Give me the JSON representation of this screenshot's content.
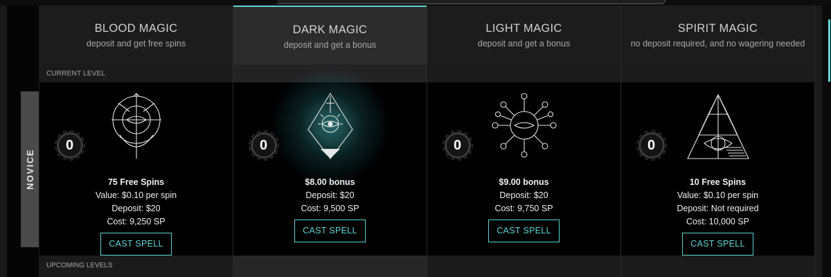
{
  "level": {
    "name": "NOVICE"
  },
  "labels": {
    "current_level": "CURRENT LEVEL",
    "upcoming_levels": "UPCOMING LEVELS"
  },
  "accent": "#5ed6d6",
  "columns": [
    {
      "title": "BLOOD MAGIC",
      "subtitle": "deposit and get free spins",
      "badge": "0",
      "icon": "blood-magic-sigil-icon",
      "offer": [
        "75 Free Spins",
        "Value: $0.10 per spin",
        "Deposit: $20",
        "Cost: 9,250 SP"
      ],
      "button": "CAST SPELL",
      "active": false
    },
    {
      "title": "DARK MAGIC",
      "subtitle": "deposit and get a bonus",
      "badge": "0",
      "icon": "dark-magic-sigil-icon",
      "offer": [
        "$8.00 bonus",
        "Deposit: $20",
        "Cost: 9,500 SP"
      ],
      "button": "CAST SPELL",
      "active": true
    },
    {
      "title": "LIGHT MAGIC",
      "subtitle": "deposit and get a bonus",
      "badge": "0",
      "icon": "light-magic-sigil-icon",
      "offer": [
        "$9.00 bonus",
        "Deposit: $20",
        "Cost: 9,750 SP"
      ],
      "button": "CAST SPELL",
      "active": false
    },
    {
      "title": "SPIRIT MAGIC",
      "subtitle": "no deposit required, and no wagering needed",
      "badge": "0",
      "icon": "spirit-magic-sigil-icon",
      "offer": [
        "10 Free Spins",
        "Value: $0.10 per spin",
        "Deposit: Not required",
        "Cost: 10,000 SP"
      ],
      "button": "CAST SPELL",
      "active": false
    }
  ]
}
